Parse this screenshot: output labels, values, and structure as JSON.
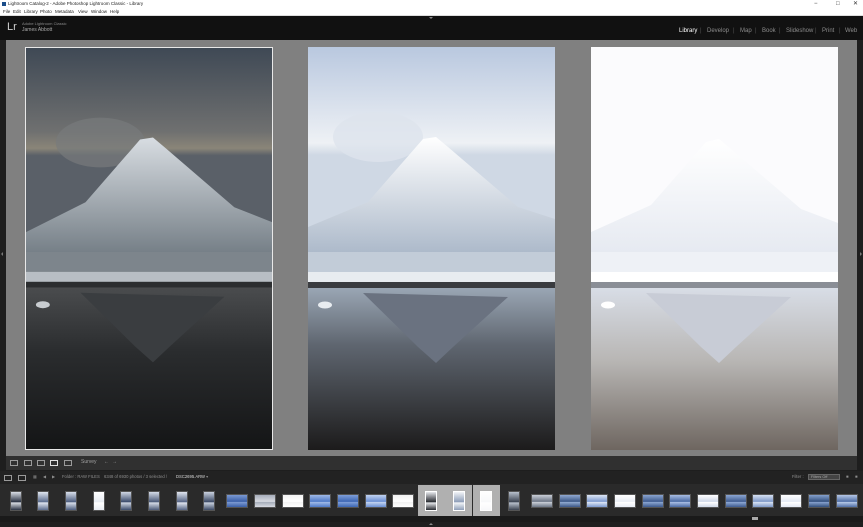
{
  "window": {
    "title": "Lightroom Catalog-2 - Adobe Photoshop Lightroom Classic - Library",
    "minimize": "−",
    "maximize": "□",
    "close": "✕"
  },
  "menu": [
    "File",
    "Edit",
    "Library",
    "Photo",
    "Metadata",
    "View",
    "Window",
    "Help"
  ],
  "identity": {
    "logo": "Lr",
    "subtitle": "Adobe Lightroom Classic",
    "name": "James Abbott"
  },
  "modules": [
    "Library",
    "Develop",
    "Map",
    "Book",
    "Slideshow",
    "Print",
    "Web"
  ],
  "active_module": "Library",
  "toolbar": {
    "sort_label": "Survey",
    "prev_arrow": "←",
    "next_arrow": "→"
  },
  "filmstrip_bar": {
    "page1": "1",
    "page2": "2",
    "folder": "Folder : RAW FILES",
    "count": "6348 of 6930 photos / 3 selected /",
    "filename": "DSC2695.ARW",
    "filter_label": "Filter :",
    "filter_value": "Filters Off"
  },
  "colors": {
    "accent_selected": "#b0b0b0",
    "identity_plate": "#111111",
    "survey_background": "#808080"
  }
}
